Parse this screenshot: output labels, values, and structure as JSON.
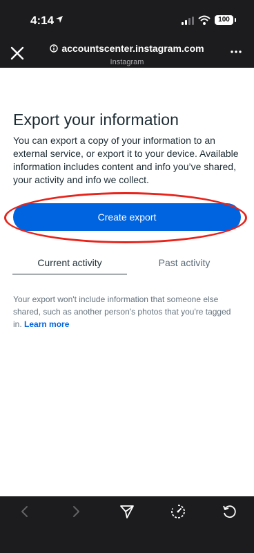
{
  "status_bar": {
    "time": "4:14",
    "battery": "100"
  },
  "header": {
    "url": "accountscenter.instagram.com",
    "subtitle": "Instagram"
  },
  "page": {
    "title": "Export your information",
    "description": "You can export a copy of your information to an external service, or export it to your device. Available information includes content and info you’ve shared, your activity and info we collect.",
    "create_button": "Create export",
    "tabs": [
      {
        "label": "Current activity"
      },
      {
        "label": "Past activity"
      }
    ],
    "note": "Your export won't include information that someone else shared, such as another person's photos that you're tagged in.",
    "learn_more": "Learn more"
  },
  "colors": {
    "accent": "#0064e0",
    "annotation": "#e8231a",
    "chrome": "#1c1c1e"
  },
  "bottom_bar": {
    "icons": [
      "back-icon",
      "forward-icon",
      "share-icon",
      "speed-icon",
      "refresh-icon"
    ]
  }
}
